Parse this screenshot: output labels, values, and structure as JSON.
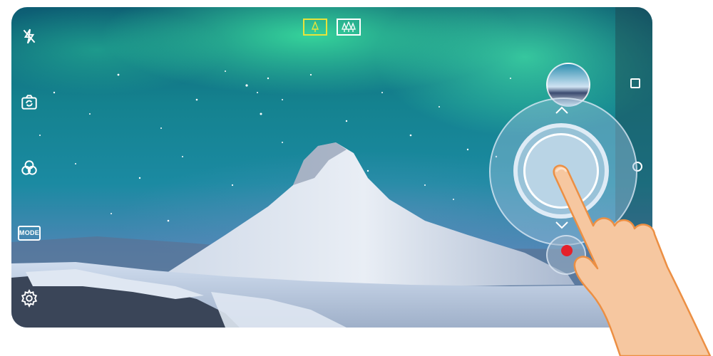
{
  "left_toolbar": {
    "flash_icon": "flash-off-icon",
    "switch_icon": "camera-switch-icon",
    "filter_icon": "beauty-filter-icon",
    "mode_label": "MODE",
    "settings_icon": "settings-icon"
  },
  "lens_selector": {
    "items": [
      {
        "icon": "single-tree-icon",
        "active": true,
        "color": "#e8e33a"
      },
      {
        "icon": "multi-tree-icon",
        "active": false,
        "color": "#ffffff"
      }
    ]
  },
  "right_bar": {
    "nav_square_icon": "recent-apps-icon",
    "nav_circle_icon": "home-icon"
  },
  "shutter": {
    "up_icon": "chevron-up-icon",
    "down_icon": "chevron-down-icon",
    "record_color": "#e5202a"
  },
  "colors": {
    "sky_top": "#0d5d73",
    "aurora": "#3ce6a0",
    "active_lens": "#e8e33a"
  }
}
